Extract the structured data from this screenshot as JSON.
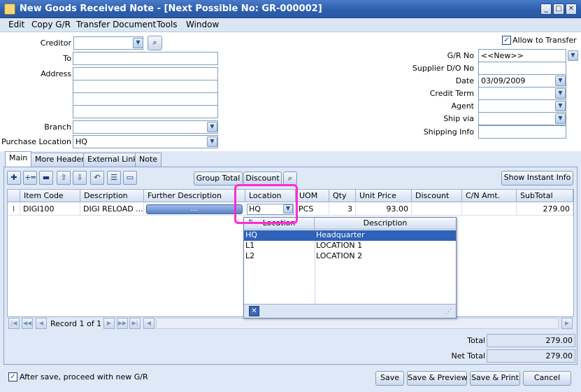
{
  "window": {
    "title": "New Goods Received Note - [Next Possible No: GR-000002]",
    "minimize": "_",
    "maximize": "□",
    "close": "✕"
  },
  "menu": [
    "Edit",
    "Copy G/R",
    "Transfer Document",
    "Tools",
    "Window"
  ],
  "header": {
    "creditor_label": "Creditor",
    "to_label": "To",
    "address_label": "Address",
    "branch_label": "Branch",
    "purchase_location_label": "Purchase Location",
    "purchase_location_value": "HQ",
    "allow_transfer_label": "Allow to Transfer",
    "allow_transfer_checked": "✓",
    "gr_no_label": "G/R  No",
    "gr_no_value": "<<New>>",
    "supplier_do_label": "Supplier D/O No",
    "date_label": "Date",
    "date_value": "03/09/2009",
    "credit_term_label": "Credit Term",
    "agent_label": "Agent",
    "ship_via_label": "Ship via",
    "shipping_info_label": "Shipping Info"
  },
  "tabs": [
    "Main",
    "More Header",
    "External Link",
    "Note"
  ],
  "toolbar": {
    "group_total": "Group Total",
    "discount": "Discount",
    "show_instant_info": "Show Instant Info"
  },
  "grid": {
    "columns": [
      "Item Code",
      "Description",
      "Further Description",
      "Location",
      "UOM",
      "Qty",
      "Unit Price",
      "Discount",
      "C/N Amt.",
      "SubTotal"
    ],
    "row_marker": "I",
    "row": {
      "item_code": "DIGI100",
      "description": "DIGI RELOAD ...",
      "further_description": "...",
      "location": "HQ",
      "uom": "PCS",
      "qty": "3",
      "unit_price": "93.00",
      "discount": "",
      "cn_amt": "",
      "subtotal": "279.00"
    }
  },
  "location_popup": {
    "columns": [
      "Location",
      "Description"
    ],
    "rows": [
      {
        "code": "HQ",
        "desc": "Headquarter"
      },
      {
        "code": "L1",
        "desc": "LOCATION 1"
      },
      {
        "code": "L2",
        "desc": "LOCATION 2"
      }
    ]
  },
  "navigator": {
    "record_text": "Record 1 of 1"
  },
  "totals": {
    "total_label": "Total",
    "total_value": "279.00",
    "net_total_label": "Net Total",
    "net_total_value": "279.00"
  },
  "footer": {
    "after_save_label": "After save, proceed with new G/R",
    "after_save_checked": "✓",
    "save": "Save",
    "save_preview": "Save & Preview",
    "save_print": "Save & Print",
    "cancel": "Cancel"
  },
  "colors": {
    "title_bar": "#2d5fb0",
    "highlight": "#ff2bd4",
    "selected_row": "#2e62b8",
    "panel": "#dfe8f6"
  }
}
